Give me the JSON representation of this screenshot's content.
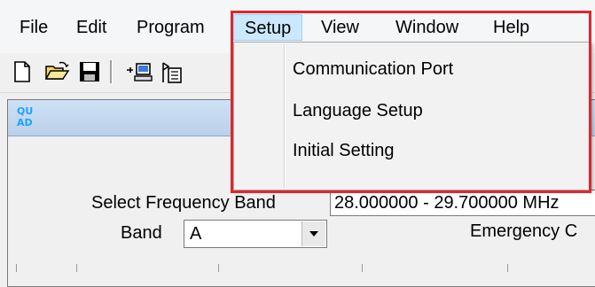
{
  "menubar": {
    "items": [
      {
        "label": "File"
      },
      {
        "label": "Edit"
      },
      {
        "label": "Program"
      },
      {
        "label": "Setup"
      },
      {
        "label": "View"
      },
      {
        "label": "Window"
      },
      {
        "label": "Help"
      }
    ],
    "active": "Setup"
  },
  "toolbar": {
    "icons": [
      "new-file-icon",
      "open-folder-icon",
      "save-disk-icon",
      "read-from-radio-icon",
      "write-to-radio-icon"
    ]
  },
  "child_window": {
    "icon_text_top": "QU",
    "icon_text_bottom": "AD",
    "select_freq_label": "Select Frequency Band",
    "freq_value": "28.000000 - 29.700000 MHz",
    "band_label": "Band",
    "band_value": "A",
    "emergency_label": "Emergency C"
  },
  "setup_menu": {
    "items": [
      {
        "label": "Communication Port"
      },
      {
        "label": "Language Setup"
      },
      {
        "label": "Initial Setting"
      }
    ]
  },
  "colors": {
    "highlight_border": "#e0262f",
    "active_menu_bg": "#cce8ff",
    "title_gradient_top": "#cfe1f4"
  }
}
